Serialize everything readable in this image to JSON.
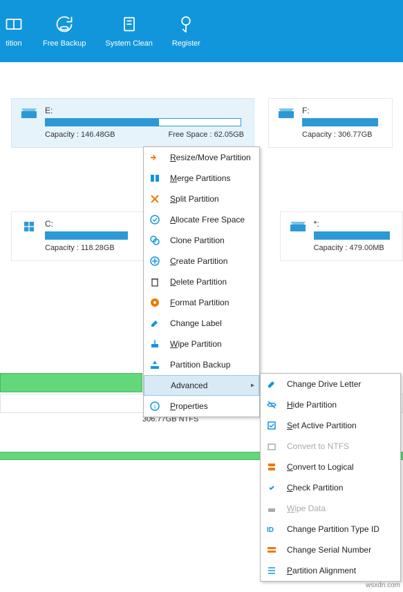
{
  "toolbar": [
    {
      "label": "tition",
      "icon": "partition"
    },
    {
      "label": "Free Backup",
      "icon": "backup"
    },
    {
      "label": "System Clean",
      "icon": "clean"
    },
    {
      "label": "Register",
      "icon": "register"
    }
  ],
  "drives": {
    "e": {
      "letter": "E:",
      "capacity": "Capacity : 146.48GB",
      "free": "Free Space : 62.05GB",
      "fill": 58
    },
    "f": {
      "letter": "F:",
      "capacity": "Capacity : 306.77GB",
      "fill": 100
    },
    "c": {
      "letter": "C:",
      "capacity": "Capacity : 118.28GB",
      "fill": 100
    },
    "star": {
      "letter": "*:",
      "capacity": "Capacity : 479.00MB",
      "fill": 100
    }
  },
  "ctx": [
    {
      "label": "Resize/Move Partition",
      "u": "R"
    },
    {
      "label": "Merge Partitions",
      "u": "M"
    },
    {
      "label": "Split Partition",
      "u": "S"
    },
    {
      "label": "Allocate Free Space",
      "u": "A"
    },
    {
      "label": "Clone Partition",
      "u": ""
    },
    {
      "label": "Create Partition",
      "u": "C"
    },
    {
      "label": "Delete Partition",
      "u": "D"
    },
    {
      "label": "Format Partition",
      "u": "F"
    },
    {
      "label": "Change Label",
      "u": ""
    },
    {
      "label": "Wipe Partition",
      "u": "W"
    },
    {
      "label": "Partition Backup",
      "u": ""
    },
    {
      "label": "Advanced",
      "u": "",
      "sub": true
    },
    {
      "label": "Properties",
      "u": "P"
    }
  ],
  "sub": [
    {
      "label": "Change Drive Letter",
      "u": ""
    },
    {
      "label": "Hide Partition",
      "u": "H"
    },
    {
      "label": "Set Active Partition",
      "u": "S"
    },
    {
      "label": "Convert to NTFS",
      "u": "",
      "disabled": true
    },
    {
      "label": "Convert to Logical",
      "u": "C"
    },
    {
      "label": "Check Partition",
      "u": "C"
    },
    {
      "label": "Wipe Data",
      "u": "W",
      "disabled": true
    },
    {
      "label": "Change Partition Type ID",
      "u": ""
    },
    {
      "label": "Change Serial Number",
      "u": ""
    },
    {
      "label": "Partition Alignment",
      "u": "P"
    }
  ],
  "disklabel": "306.77GB NTFS",
  "watermark": "wsxdn.com"
}
